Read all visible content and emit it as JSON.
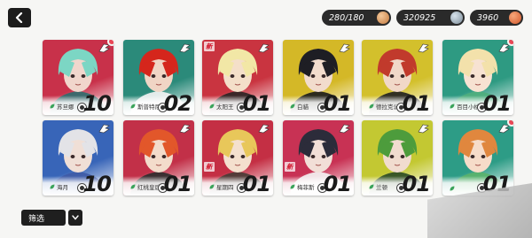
{
  "header": {
    "back_icon": "chevron-left-icon"
  },
  "currencies": [
    {
      "id": "stamina",
      "value": "280/180",
      "icon": "stamina-coin-icon",
      "color": "#c47a3e"
    },
    {
      "id": "silver",
      "value": "320925",
      "icon": "silver-coin-icon",
      "color": "#7d8d99"
    },
    {
      "id": "crystal",
      "value": "3960",
      "icon": "crystal-coin-icon",
      "color": "#d3582c"
    }
  ],
  "cards": [
    {
      "name": "苏旦娜",
      "count": "10",
      "new": "",
      "dot": true,
      "bg": "#c8314a",
      "hair": "#7cd6c4",
      "face": "#f1d6cc",
      "accent": "#2c6d6e"
    },
    {
      "name": "斯普特尼克",
      "count": "02",
      "new": "",
      "dot": false,
      "bg": "#2b8a7a",
      "hair": "#d5261c",
      "face": "#f0d5c5",
      "accent": "#f5f5f5"
    },
    {
      "name": "太阳王",
      "count": "01",
      "new": "新",
      "dot": false,
      "bg": "#c93440",
      "hair": "#f2e7a6",
      "face": "#f4dfc9",
      "accent": "#2a2424"
    },
    {
      "name": "白貓",
      "count": "01",
      "new": "",
      "dot": false,
      "bg": "#d4b827",
      "hair": "#1e1e24",
      "face": "#f2dccd",
      "accent": "#1a1a1a"
    },
    {
      "name": "德拉克公爵",
      "count": "01",
      "new": "",
      "dot": false,
      "bg": "#d3c02c",
      "hair": "#c13a2c",
      "face": "#f1d8c8",
      "accent": "#1f1f1f"
    },
    {
      "name": "百目小桃",
      "count": "01",
      "new": "",
      "dot": true,
      "bg": "#2e9a82",
      "hair": "#f3e1ab",
      "face": "#f7e2d2",
      "accent": "#4fae7c"
    },
    {
      "name": "海月",
      "count": "10",
      "new": "",
      "dot": false,
      "bg": "#3865b8",
      "hair": "#e3e3e7",
      "face": "#f0dfd6",
      "accent": "#3e5aa5"
    },
    {
      "name": "红桃皇后",
      "count": "01",
      "new": "",
      "dot": false,
      "bg": "#c23048",
      "hair": "#e2572a",
      "face": "#f3dccb",
      "accent": "#2c2c2c"
    },
    {
      "name": "星期四",
      "count": "01",
      "new": "新",
      "dot": false,
      "bg": "#c42f44",
      "hair": "#e8c75a",
      "face": "#f4e0ce",
      "accent": "#473b35"
    },
    {
      "name": "梅菲斯",
      "count": "01",
      "new": "新",
      "dot": false,
      "bg": "#c83254",
      "hair": "#2c2c3a",
      "face": "#f2dfd7",
      "accent": "#f4f4f4"
    },
    {
      "name": "兰顿",
      "count": "01",
      "new": "",
      "dot": false,
      "bg": "#c3c832",
      "hair": "#4d9c3c",
      "face": "#f1dccf",
      "accent": "#2a4a24"
    },
    {
      "name": "",
      "count": "01",
      "new": "",
      "dot": true,
      "bg": "#2d9c86",
      "hair": "#e0873e",
      "face": "#f6dcc9",
      "accent": "#5ab36a"
    }
  ],
  "filter": {
    "label": "筛选",
    "toggle_icon": "chevron-down-icon"
  }
}
